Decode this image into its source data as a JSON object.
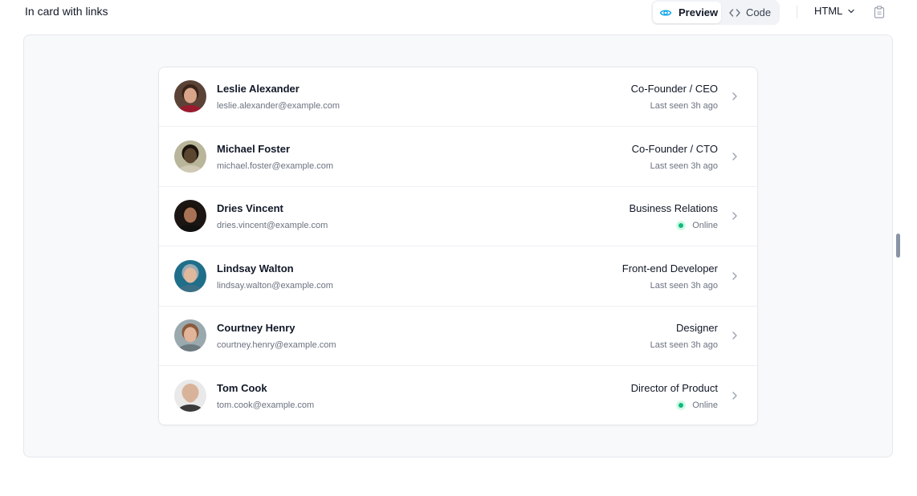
{
  "header": {
    "title": "In card with links",
    "toggle": {
      "preview_label": "Preview",
      "code_label": "Code"
    },
    "language": "HTML",
    "icons": {
      "preview": "eye-icon",
      "code": "code-brackets-icon",
      "language": "chevron-down-icon",
      "copy": "clipboard-icon"
    }
  },
  "people": [
    {
      "name": "Leslie Alexander",
      "email": "leslie.alexander@example.com",
      "role": "Co-Founder / CEO",
      "status": "Last seen 3h ago",
      "online": false,
      "avatar": {
        "skin": "#d9a58a",
        "hair": "#3a2418",
        "shirt": "#9b1b2e",
        "bg": "#5a4236"
      }
    },
    {
      "name": "Michael Foster",
      "email": "michael.foster@example.com",
      "role": "Co-Founder / CTO",
      "status": "Last seen 3h ago",
      "online": false,
      "avatar": {
        "skin": "#5b4630",
        "hair": "#1c140c",
        "shirt": "#cfc8b4",
        "bg": "#b9b59a"
      }
    },
    {
      "name": "Dries Vincent",
      "email": "dries.vincent@example.com",
      "role": "Business Relations",
      "status": "Online",
      "online": true,
      "avatar": {
        "skin": "#a87355",
        "hair": "#1a120c",
        "shirt": "#111111",
        "bg": "#1b1613"
      }
    },
    {
      "name": "Lindsay Walton",
      "email": "lindsay.walton@example.com",
      "role": "Front-end Developer",
      "status": "Last seen 3h ago",
      "online": false,
      "avatar": {
        "skin": "#e0b89c",
        "hair": "#9aaab3",
        "shirt": "#3b6f86",
        "bg": "#1f6e8a"
      }
    },
    {
      "name": "Courtney Henry",
      "email": "courtney.henry@example.com",
      "role": "Designer",
      "status": "Last seen 3h ago",
      "online": false,
      "avatar": {
        "skin": "#e2b49a",
        "hair": "#8a5a3c",
        "shirt": "#6d7a7f",
        "bg": "#9aa9ad"
      }
    },
    {
      "name": "Tom Cook",
      "email": "tom.cook@example.com",
      "role": "Director of Product",
      "status": "Online",
      "online": true,
      "avatar": {
        "skin": "#d8b39a",
        "hair": "#d8b39a",
        "shirt": "#3a3a3a",
        "bg": "#e9e9e9"
      }
    }
  ],
  "colors": {
    "online": "#10b981",
    "online_ring": "#d1fae5",
    "frame_bg": "#f8f9fb",
    "border": "#e5e7eb"
  }
}
